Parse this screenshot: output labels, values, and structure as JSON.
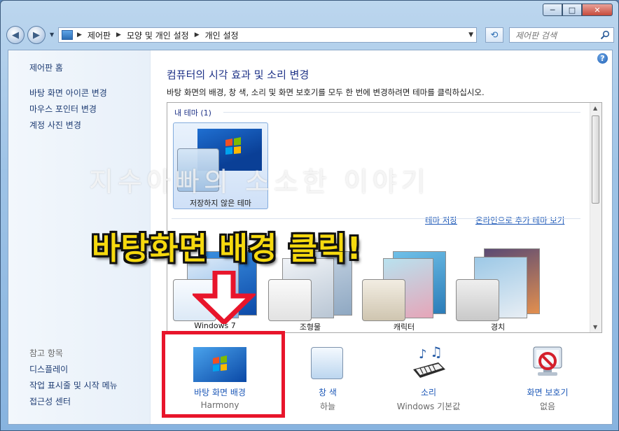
{
  "window": {
    "buttons": {
      "minimize": "─",
      "maximize": "□",
      "close": "✕"
    }
  },
  "address": {
    "crumbs": [
      "제어판",
      "모양 및 개인 설정",
      "개인 설정"
    ],
    "search_placeholder": "제어판 검색"
  },
  "sidebar": {
    "home": "제어판 홈",
    "links": [
      "바탕 화면 아이콘 변경",
      "마우스 포인터 변경",
      "계정 사진 변경"
    ],
    "see_also_title": "참고 항목",
    "see_also": [
      "디스플레이",
      "작업 표시줄 및 시작 메뉴",
      "접근성 센터"
    ]
  },
  "main": {
    "title": "컴퓨터의 시각 효과 및 소리 변경",
    "description": "바탕 화면의 배경, 창 색, 소리 및 화면 보호기를 모두 한 번에 변경하려면 테마를 클릭하십시오.",
    "my_themes_header": "내 테마 (1)",
    "unsaved_theme": "저장하지 않은 테마",
    "save_theme_link": "테마 저장",
    "online_themes_link": "온라인으로 추가 테마 보기",
    "themes": [
      "Windows 7",
      "조형물",
      "캐릭터",
      "경치"
    ]
  },
  "bottom": [
    {
      "title": "바탕 화면 배경",
      "subtitle": "Harmony",
      "icon": "desktop-background-icon"
    },
    {
      "title": "창 색",
      "subtitle": "하늘",
      "icon": "window-color-icon"
    },
    {
      "title": "소리",
      "subtitle": "Windows 기본값",
      "icon": "sounds-icon"
    },
    {
      "title": "화면 보호기",
      "subtitle": "없음",
      "icon": "screensaver-icon"
    }
  ],
  "overlay": {
    "watermark": "지수아빠의 소소한 이야기",
    "annotation": "바탕화면 배경 클릭!"
  },
  "colors": {
    "annotation_text": "#f6d90e",
    "highlight_box": "#e8152b",
    "link": "#1e59b8",
    "heading": "#1e3287"
  }
}
